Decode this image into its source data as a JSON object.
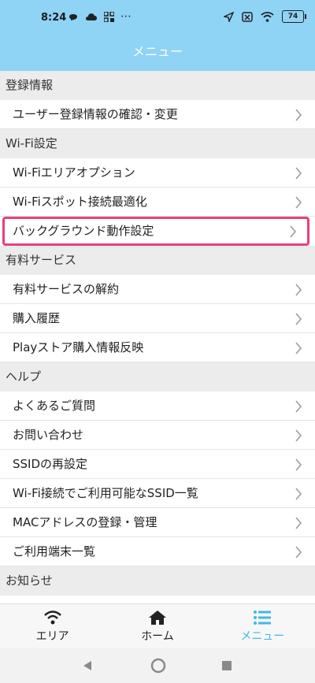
{
  "status": {
    "time": "8:24",
    "more": "⋯",
    "battery": "74"
  },
  "appbar": {
    "title": "メニュー"
  },
  "sections": [
    {
      "title": "登録情報",
      "items": [
        "ユーザー登録情報の確認・変更"
      ]
    },
    {
      "title": "Wi-Fi設定",
      "items": [
        "Wi-Fiエリアオプション",
        "Wi-Fiスポット接続最適化",
        "バックグラウンド動作設定"
      ]
    },
    {
      "title": "有料サービス",
      "items": [
        "有料サービスの解約",
        "購入履歴",
        "Playストア購入情報反映"
      ]
    },
    {
      "title": "ヘルプ",
      "items": [
        "よくあるご質問",
        "お問い合わせ",
        "SSIDの再設定",
        "Wi-Fi接続でご利用可能なSSID一覧",
        "MACアドレスの登録・管理",
        "ご利用端末一覧"
      ]
    },
    {
      "title": "お知らせ",
      "items": []
    }
  ],
  "tabs": {
    "area": "エリア",
    "home": "ホーム",
    "menu": "メニュー"
  },
  "colors": {
    "accent": "#8fd3f5",
    "active_tab": "#42b7e8",
    "highlight": "#e8417a"
  }
}
